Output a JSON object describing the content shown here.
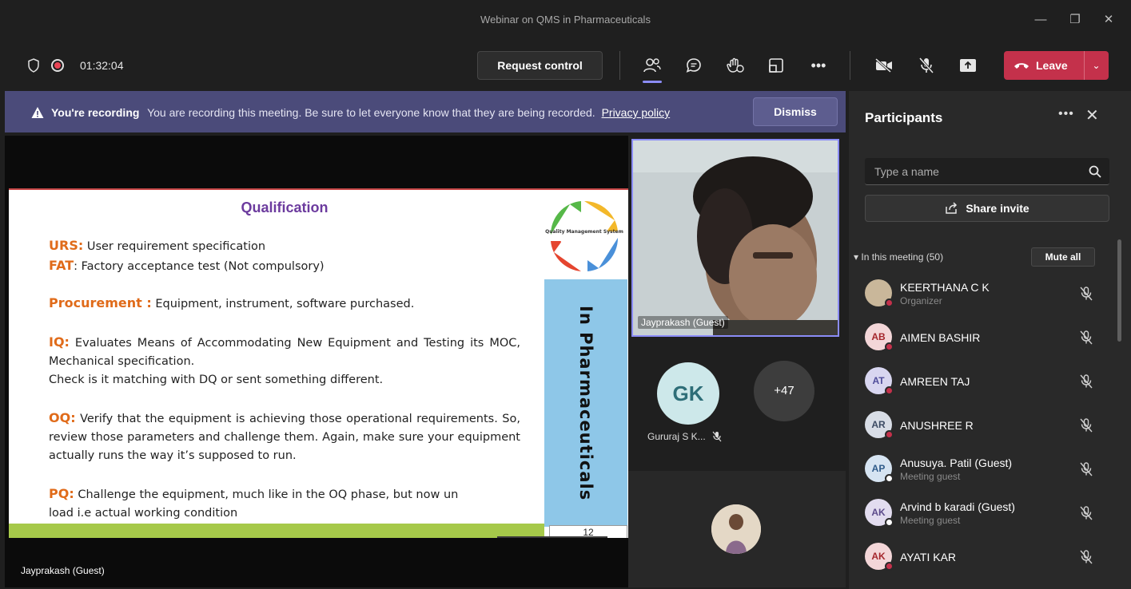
{
  "window": {
    "title": "Webinar on QMS in Pharmaceuticals"
  },
  "toolbar": {
    "timer": "01:32:04",
    "request_control": "Request control",
    "leave": "Leave"
  },
  "banner": {
    "heading": "You're recording",
    "message": "You are recording this meeting. Be sure to let everyone know that they are being recorded.",
    "link": "Privacy policy",
    "dismiss": "Dismiss"
  },
  "slide": {
    "title": "Qualification",
    "urs_key": "URS:",
    "urs_text": " User requirement specification",
    "fat_key": "FAT",
    "fat_text": ": Factory acceptance test (Not compulsory)",
    "proc_key": "Procurement :",
    "proc_text": " Equipment, instrument, software purchased.",
    "iq_key": "IQ:",
    "iq_text": " Evaluates Means of Accommodating New Equipment and Testing its MOC, Mechanical specification.",
    "iq_text2": "Check is it matching with DQ or sent something different.",
    "oq_key": "OQ:",
    "oq_text": "  Verify that the equipment is achieving those operational requirements. So, review those parameters and challenge them. Again, make sure your equipment actually runs the way it’s supposed to run.",
    "pq_key": "PQ:",
    "pq_text": " Challenge the equipment, much like in the OQ phase, but now un",
    "pq_text2": "load i.e actual working condition",
    "side_text": "In Pharmaceuticals",
    "logo_text": "Quality Management System",
    "page_number": "12"
  },
  "stage": {
    "presenter": "Jayprakash (Guest)"
  },
  "tiles": {
    "main_video_name": "Jayprakash (Guest)",
    "gk_initials": "GK",
    "gk_name": "Gururaj S K...",
    "more_count": "+47"
  },
  "panel": {
    "title": "Participants",
    "search_placeholder": "Type a name",
    "share_invite": "Share invite",
    "section_label": "In this meeting (50)",
    "mute_all": "Mute all",
    "participants": [
      {
        "initials": "",
        "name": "KEERTHANA C K",
        "sub": "Organizer",
        "avatar_bg": "#c9b79a",
        "avatar_fg": "#ffffff",
        "status": "#c4314b"
      },
      {
        "initials": "AB",
        "name": "AIMEN BASHIR",
        "sub": "",
        "avatar_bg": "#f3d6d8",
        "avatar_fg": "#a4262c",
        "status": "#c4314b"
      },
      {
        "initials": "AT",
        "name": "AMREEN TAJ",
        "sub": "",
        "avatar_bg": "#d8d6f0",
        "avatar_fg": "#4f4d9a",
        "status": "#c4314b"
      },
      {
        "initials": "AR",
        "name": "ANUSHREE R",
        "sub": "",
        "avatar_bg": "#d8dde6",
        "avatar_fg": "#3b4a63",
        "status": "#c4314b"
      },
      {
        "initials": "AP",
        "name": "Anusuya. Patil (Guest)",
        "sub": "Meeting guest",
        "avatar_bg": "#d6e4f2",
        "avatar_fg": "#2f5b8a",
        "status": "#ffffff"
      },
      {
        "initials": "AK",
        "name": "Arvind b karadi (Guest)",
        "sub": "Meeting guest",
        "avatar_bg": "#e2dcef",
        "avatar_fg": "#5b4a8a",
        "status": "#ffffff"
      },
      {
        "initials": "AK",
        "name": "AYATI KAR",
        "sub": "",
        "avatar_bg": "#f3d6d8",
        "avatar_fg": "#a4262c",
        "status": "#c4314b"
      }
    ]
  },
  "colors": {
    "accent": "#8b8cf7",
    "leave_red": "#c4314b",
    "banner": "#4b4b7a"
  }
}
